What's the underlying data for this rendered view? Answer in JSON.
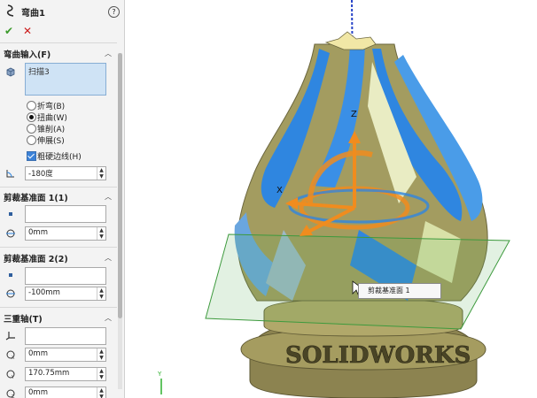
{
  "panel": {
    "title": "弯曲1",
    "help": "?",
    "ok": "✔",
    "cancel": "✕"
  },
  "bend_input": {
    "header": "弯曲输入(F)",
    "selection": "扫描3",
    "options": [
      {
        "label": "折弯(B)",
        "selected": false
      },
      {
        "label": "扭曲(W)",
        "selected": true
      },
      {
        "label": "锥削(A)",
        "selected": false
      },
      {
        "label": "伸展(S)",
        "selected": false
      }
    ],
    "hard_edges_label": "粗硬边线(H)",
    "hard_edges_checked": true,
    "angle_value": "-180度"
  },
  "trim_plane1": {
    "header": "剪裁基准面 1(1)",
    "distance_value": "0mm"
  },
  "trim_plane2": {
    "header": "剪裁基准面 2(2)",
    "distance_value": "-100mm"
  },
  "triad": {
    "header": "三重轴(T)",
    "x_value": "0mm",
    "y_value": "170.75mm",
    "z_value": "0mm"
  },
  "viewport": {
    "tooltip": "剪裁基准面 1",
    "model_text": "SOLIDWORKS",
    "triad_x": "X",
    "triad_y": "Y",
    "triad_z": "Z"
  },
  "colors": {
    "accent_blue": "#2f86e0",
    "model_gold": "#a09a5a",
    "plane_green": "#4caf50",
    "triad_orange": "#f08c1e"
  }
}
